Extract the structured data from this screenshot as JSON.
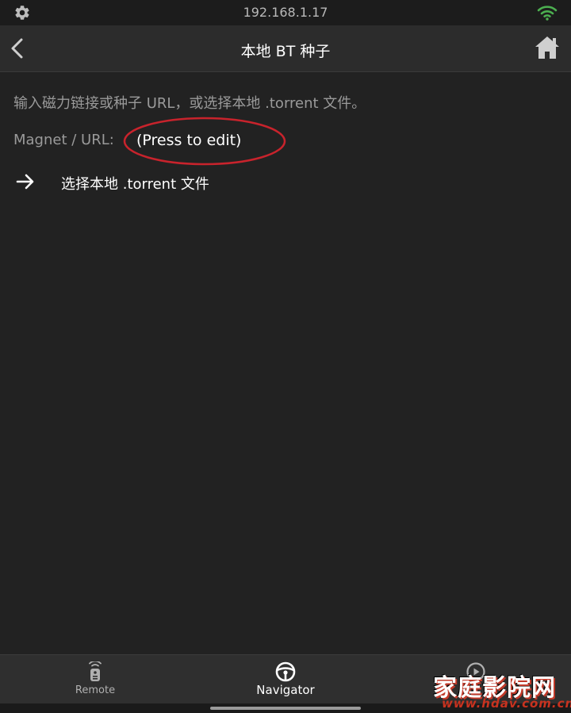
{
  "status_bar": {
    "ip": "192.168.1.17",
    "left_icon": "gear-icon",
    "right_icon": "wifi-icon",
    "wifi_color": "#4caf50"
  },
  "nav_bar": {
    "title": "本地 BT 种子",
    "back_icon": "chevron-left-icon",
    "home_icon": "home-icon"
  },
  "content": {
    "hint": "输入磁力链接或种子 URL，或选择本地 .torrent 文件。",
    "magnet_label": "Magnet / URL:",
    "magnet_value": "(Press to edit)",
    "local_file_label": "选择本地 .torrent 文件",
    "local_file_icon": "arrow-right-icon",
    "highlight_color": "#c8232c"
  },
  "tab_bar": {
    "tabs": [
      {
        "label": "Remote",
        "icon": "remote-icon",
        "active": false
      },
      {
        "label": "Navigator",
        "icon": "steering-wheel-icon",
        "active": true
      },
      {
        "label": "",
        "icon": "play-circle-icon",
        "active": false
      }
    ]
  },
  "watermark": {
    "title": "家庭影院网",
    "url": "www.hdav.com.cn"
  }
}
